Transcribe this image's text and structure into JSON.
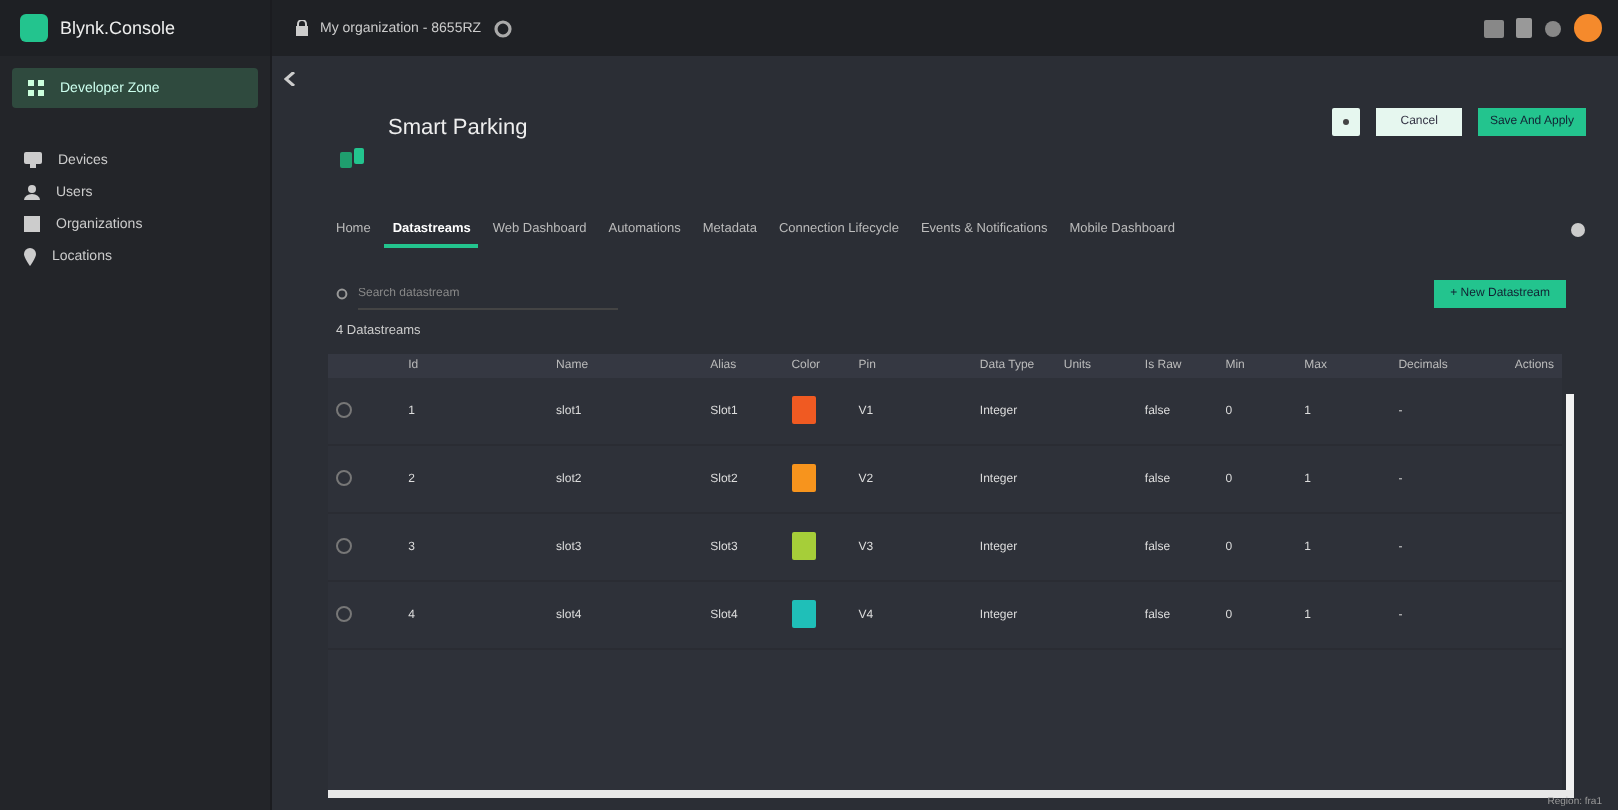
{
  "brand": "Blynk.Console",
  "sidebar": {
    "items": [
      {
        "label": "Developer Zone",
        "selected": true,
        "kind": "zone"
      },
      {
        "label": "Devices",
        "selected": false,
        "kind": "devices"
      },
      {
        "label": "Users",
        "selected": false,
        "kind": "users"
      },
      {
        "label": "Organizations",
        "selected": false,
        "kind": "orgs"
      },
      {
        "label": "Locations",
        "selected": false,
        "kind": "locations"
      }
    ]
  },
  "topbar": {
    "organization": "My organization - 8655RZ"
  },
  "template": {
    "title": "Smart Parking"
  },
  "actions": [
    "Cancel",
    "Save And Apply"
  ],
  "tabs": [
    {
      "label": "Home",
      "selected": false
    },
    {
      "label": "Datastreams",
      "selected": true
    },
    {
      "label": "Web Dashboard",
      "selected": false
    },
    {
      "label": "Automations",
      "selected": false
    },
    {
      "label": "Metadata",
      "selected": false
    },
    {
      "label": "Connection Lifecycle",
      "selected": false
    },
    {
      "label": "Events & Notifications",
      "selected": false
    },
    {
      "label": "Mobile Dashboard",
      "selected": false
    }
  ],
  "search": {
    "placeholder": "Search datastream"
  },
  "new_button": "+ New Datastream",
  "count": "4 Datastreams",
  "table": {
    "columns": [
      "Id",
      "Name",
      "Alias",
      "Color",
      "Pin",
      "Data Type",
      "Units",
      "Is Raw",
      "Min",
      "Max",
      "Decimals",
      "Actions"
    ],
    "rows": [
      {
        "checked": false,
        "id": "1",
        "name": "slot1",
        "alias": "Slot1",
        "color": "#f05a22",
        "pin": "V1",
        "type": "Integer",
        "units": "",
        "raw": "false",
        "min": "0",
        "max": "1",
        "decimals": "-"
      },
      {
        "checked": false,
        "id": "2",
        "name": "slot2",
        "alias": "Slot2",
        "color": "#f7941d",
        "pin": "V2",
        "type": "Integer",
        "units": "",
        "raw": "false",
        "min": "0",
        "max": "1",
        "decimals": "-"
      },
      {
        "checked": false,
        "id": "3",
        "name": "slot3",
        "alias": "Slot3",
        "color": "#a6ce39",
        "pin": "V3",
        "type": "Integer",
        "units": "",
        "raw": "false",
        "min": "0",
        "max": "1",
        "decimals": "-"
      },
      {
        "checked": false,
        "id": "4",
        "name": "slot4",
        "alias": "Slot4",
        "color": "#1fbfb8",
        "pin": "V4",
        "type": "Integer",
        "units": "",
        "raw": "false",
        "min": "0",
        "max": "1",
        "decimals": "-"
      }
    ]
  },
  "footer": "Region: fra1"
}
